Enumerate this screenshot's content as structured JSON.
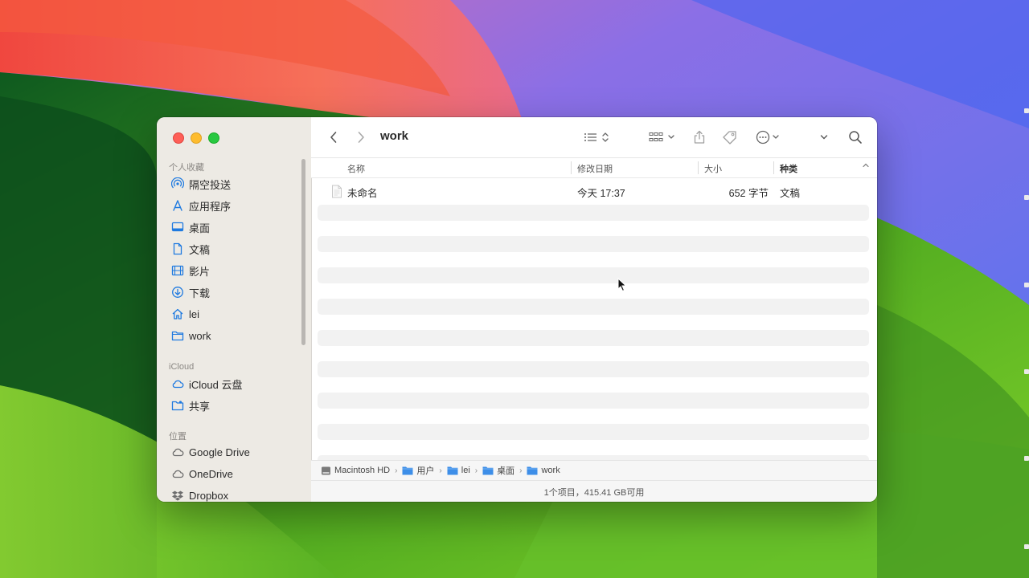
{
  "window": {
    "title": "work"
  },
  "sidebar": {
    "favorites_header": "个人收藏",
    "favorites": [
      {
        "label": "隔空投送",
        "icon": "airdrop-icon"
      },
      {
        "label": "应用程序",
        "icon": "applications-icon"
      },
      {
        "label": "桌面",
        "icon": "desktop-icon"
      },
      {
        "label": "文稿",
        "icon": "document-icon"
      },
      {
        "label": "影片",
        "icon": "film-icon"
      },
      {
        "label": "下载",
        "icon": "download-icon"
      },
      {
        "label": "lei",
        "icon": "home-icon"
      },
      {
        "label": "work",
        "icon": "folder-icon"
      }
    ],
    "icloud_header": "iCloud",
    "icloud": [
      {
        "label": "iCloud 云盘",
        "icon": "cloud-icon"
      },
      {
        "label": "共享",
        "icon": "shared-folder-icon"
      }
    ],
    "locations_header": "位置",
    "locations": [
      {
        "label": "Google Drive",
        "icon": "cloud-icon"
      },
      {
        "label": "OneDrive",
        "icon": "cloud-icon"
      },
      {
        "label": "Dropbox",
        "icon": "dropbox-icon"
      }
    ]
  },
  "columns": {
    "name": "名称",
    "modified": "修改日期",
    "size": "大小",
    "kind": "种类"
  },
  "files": [
    {
      "name": "未命名",
      "modified": "今天 17:37",
      "size": "652 字节",
      "kind": "文稿"
    }
  ],
  "pathbar": [
    "Macintosh HD",
    "用户",
    "lei",
    "桌面",
    "work"
  ],
  "status": "1个项目，415.41 GB可用",
  "colors": {
    "accent": "#1f7ae0",
    "sidebar_bg": "#ece8e2"
  }
}
